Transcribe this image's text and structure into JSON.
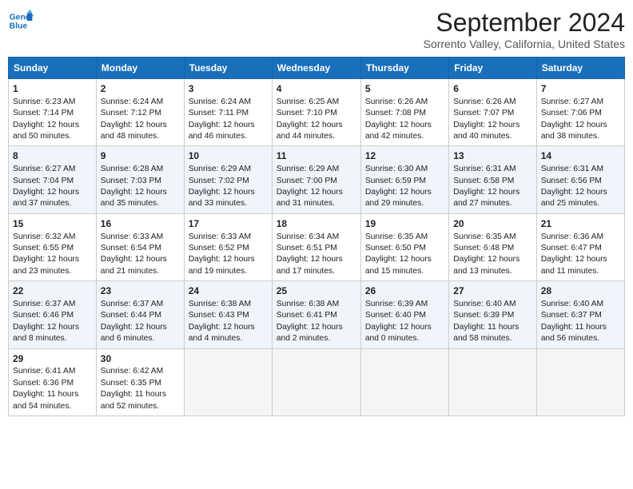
{
  "logo": {
    "line1": "General",
    "line2": "Blue"
  },
  "title": "September 2024",
  "location": "Sorrento Valley, California, United States",
  "days_of_week": [
    "Sunday",
    "Monday",
    "Tuesday",
    "Wednesday",
    "Thursday",
    "Friday",
    "Saturday"
  ],
  "weeks": [
    [
      {
        "day": "1",
        "sunrise": "Sunrise: 6:23 AM",
        "sunset": "Sunset: 7:14 PM",
        "daylight": "Daylight: 12 hours and 50 minutes."
      },
      {
        "day": "2",
        "sunrise": "Sunrise: 6:24 AM",
        "sunset": "Sunset: 7:12 PM",
        "daylight": "Daylight: 12 hours and 48 minutes."
      },
      {
        "day": "3",
        "sunrise": "Sunrise: 6:24 AM",
        "sunset": "Sunset: 7:11 PM",
        "daylight": "Daylight: 12 hours and 46 minutes."
      },
      {
        "day": "4",
        "sunrise": "Sunrise: 6:25 AM",
        "sunset": "Sunset: 7:10 PM",
        "daylight": "Daylight: 12 hours and 44 minutes."
      },
      {
        "day": "5",
        "sunrise": "Sunrise: 6:26 AM",
        "sunset": "Sunset: 7:08 PM",
        "daylight": "Daylight: 12 hours and 42 minutes."
      },
      {
        "day": "6",
        "sunrise": "Sunrise: 6:26 AM",
        "sunset": "Sunset: 7:07 PM",
        "daylight": "Daylight: 12 hours and 40 minutes."
      },
      {
        "day": "7",
        "sunrise": "Sunrise: 6:27 AM",
        "sunset": "Sunset: 7:06 PM",
        "daylight": "Daylight: 12 hours and 38 minutes."
      }
    ],
    [
      {
        "day": "8",
        "sunrise": "Sunrise: 6:27 AM",
        "sunset": "Sunset: 7:04 PM",
        "daylight": "Daylight: 12 hours and 37 minutes."
      },
      {
        "day": "9",
        "sunrise": "Sunrise: 6:28 AM",
        "sunset": "Sunset: 7:03 PM",
        "daylight": "Daylight: 12 hours and 35 minutes."
      },
      {
        "day": "10",
        "sunrise": "Sunrise: 6:29 AM",
        "sunset": "Sunset: 7:02 PM",
        "daylight": "Daylight: 12 hours and 33 minutes."
      },
      {
        "day": "11",
        "sunrise": "Sunrise: 6:29 AM",
        "sunset": "Sunset: 7:00 PM",
        "daylight": "Daylight: 12 hours and 31 minutes."
      },
      {
        "day": "12",
        "sunrise": "Sunrise: 6:30 AM",
        "sunset": "Sunset: 6:59 PM",
        "daylight": "Daylight: 12 hours and 29 minutes."
      },
      {
        "day": "13",
        "sunrise": "Sunrise: 6:31 AM",
        "sunset": "Sunset: 6:58 PM",
        "daylight": "Daylight: 12 hours and 27 minutes."
      },
      {
        "day": "14",
        "sunrise": "Sunrise: 6:31 AM",
        "sunset": "Sunset: 6:56 PM",
        "daylight": "Daylight: 12 hours and 25 minutes."
      }
    ],
    [
      {
        "day": "15",
        "sunrise": "Sunrise: 6:32 AM",
        "sunset": "Sunset: 6:55 PM",
        "daylight": "Daylight: 12 hours and 23 minutes."
      },
      {
        "day": "16",
        "sunrise": "Sunrise: 6:33 AM",
        "sunset": "Sunset: 6:54 PM",
        "daylight": "Daylight: 12 hours and 21 minutes."
      },
      {
        "day": "17",
        "sunrise": "Sunrise: 6:33 AM",
        "sunset": "Sunset: 6:52 PM",
        "daylight": "Daylight: 12 hours and 19 minutes."
      },
      {
        "day": "18",
        "sunrise": "Sunrise: 6:34 AM",
        "sunset": "Sunset: 6:51 PM",
        "daylight": "Daylight: 12 hours and 17 minutes."
      },
      {
        "day": "19",
        "sunrise": "Sunrise: 6:35 AM",
        "sunset": "Sunset: 6:50 PM",
        "daylight": "Daylight: 12 hours and 15 minutes."
      },
      {
        "day": "20",
        "sunrise": "Sunrise: 6:35 AM",
        "sunset": "Sunset: 6:48 PM",
        "daylight": "Daylight: 12 hours and 13 minutes."
      },
      {
        "day": "21",
        "sunrise": "Sunrise: 6:36 AM",
        "sunset": "Sunset: 6:47 PM",
        "daylight": "Daylight: 12 hours and 11 minutes."
      }
    ],
    [
      {
        "day": "22",
        "sunrise": "Sunrise: 6:37 AM",
        "sunset": "Sunset: 6:46 PM",
        "daylight": "Daylight: 12 hours and 8 minutes."
      },
      {
        "day": "23",
        "sunrise": "Sunrise: 6:37 AM",
        "sunset": "Sunset: 6:44 PM",
        "daylight": "Daylight: 12 hours and 6 minutes."
      },
      {
        "day": "24",
        "sunrise": "Sunrise: 6:38 AM",
        "sunset": "Sunset: 6:43 PM",
        "daylight": "Daylight: 12 hours and 4 minutes."
      },
      {
        "day": "25",
        "sunrise": "Sunrise: 6:38 AM",
        "sunset": "Sunset: 6:41 PM",
        "daylight": "Daylight: 12 hours and 2 minutes."
      },
      {
        "day": "26",
        "sunrise": "Sunrise: 6:39 AM",
        "sunset": "Sunset: 6:40 PM",
        "daylight": "Daylight: 12 hours and 0 minutes."
      },
      {
        "day": "27",
        "sunrise": "Sunrise: 6:40 AM",
        "sunset": "Sunset: 6:39 PM",
        "daylight": "Daylight: 11 hours and 58 minutes."
      },
      {
        "day": "28",
        "sunrise": "Sunrise: 6:40 AM",
        "sunset": "Sunset: 6:37 PM",
        "daylight": "Daylight: 11 hours and 56 minutes."
      }
    ],
    [
      {
        "day": "29",
        "sunrise": "Sunrise: 6:41 AM",
        "sunset": "Sunset: 6:36 PM",
        "daylight": "Daylight: 11 hours and 54 minutes."
      },
      {
        "day": "30",
        "sunrise": "Sunrise: 6:42 AM",
        "sunset": "Sunset: 6:35 PM",
        "daylight": "Daylight: 11 hours and 52 minutes."
      },
      null,
      null,
      null,
      null,
      null
    ]
  ]
}
